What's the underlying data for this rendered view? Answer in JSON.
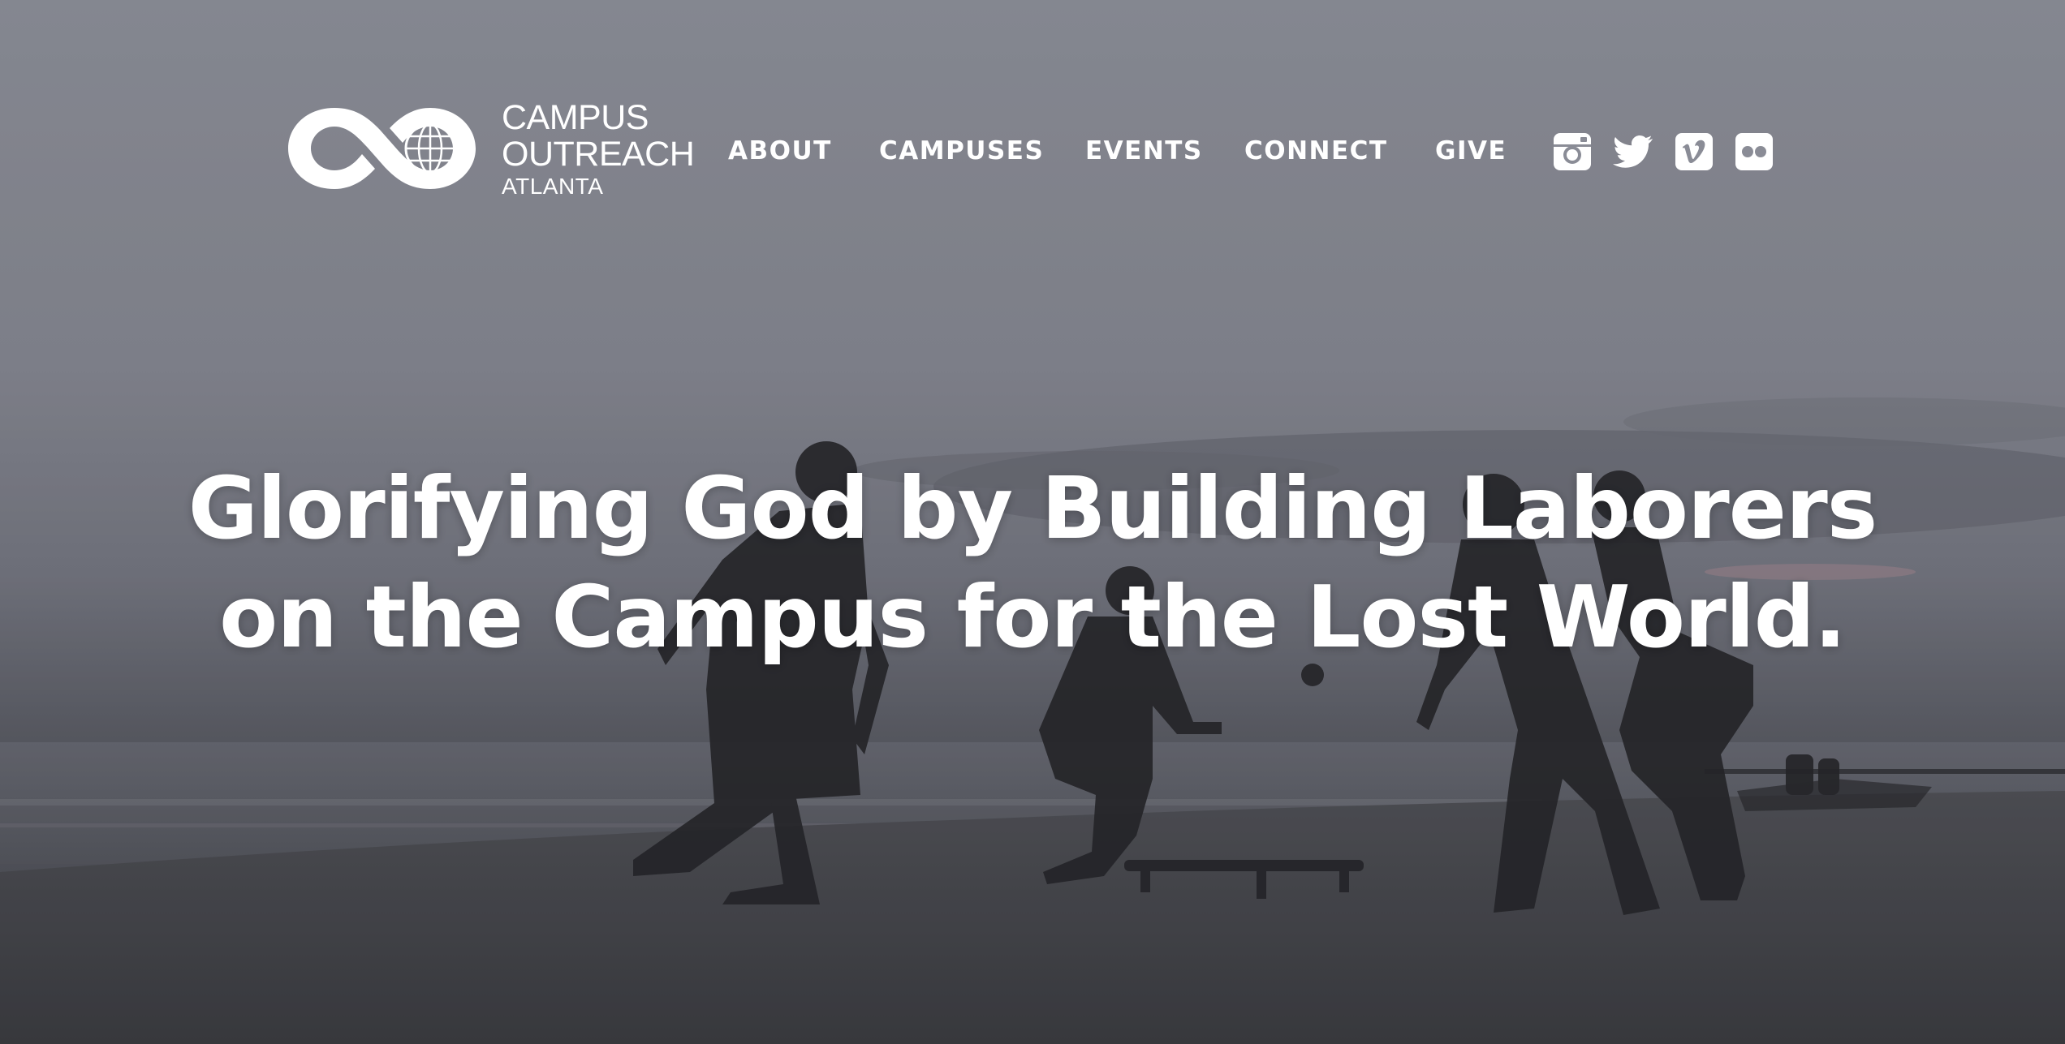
{
  "brand": {
    "line1": "CAMPUS",
    "line2": "OUTREACH",
    "line3": "ATLANTA"
  },
  "nav": {
    "items": [
      {
        "label": "ABOUT"
      },
      {
        "label": "CAMPUSES"
      },
      {
        "label": "EVENTS"
      },
      {
        "label": "CONNECT"
      },
      {
        "label": "GIVE"
      }
    ]
  },
  "social": {
    "icons": [
      "instagram-icon",
      "twitter-icon",
      "vimeo-icon",
      "flickr-icon"
    ]
  },
  "hero": {
    "line1": "Glorifying God by Building Laborers",
    "line2": "on the Campus for the Lost World."
  },
  "colors": {
    "text": "#ffffff",
    "sky_top": "#9a9ca6",
    "sand": "#4a4b50"
  }
}
